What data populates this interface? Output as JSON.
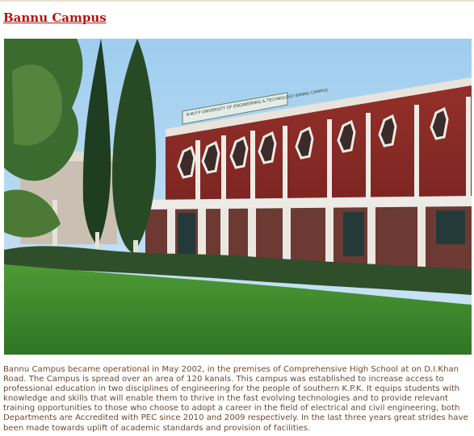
{
  "page": {
    "title": "Bannu Campus",
    "description": "Bannu Campus became operational in May 2002, in the premises of Comprehensive High School at on D.I.Khan Road. The Campus is spread over an area of 120 kanals. This campus was established to increase access to professional education in two disciplines of engineering for the people of southern K.P.K. It equips students with knowledge and skills that will enable them to thrive in the fast evolving technologies and to provide relevant training opportunities to those who choose to adopt a career in the field of electrical and civil engineering, both Departments are Accredited with PEC since 2010 and 2009 respectively. In the last three years great strides have been made towards uplift of academic standards and provision of facilities."
  },
  "photo": {
    "sign_text": "N-W.F.P UNIVERSITY OF ENGINEERING & TECHNOLOGY BANNU CAMPUS"
  },
  "colors": {
    "title": "#b0170f",
    "body_text": "#6b4a32",
    "brick": "#8a2a25",
    "sky": "#a8d4f0",
    "lawn": "#3f8a2e"
  }
}
